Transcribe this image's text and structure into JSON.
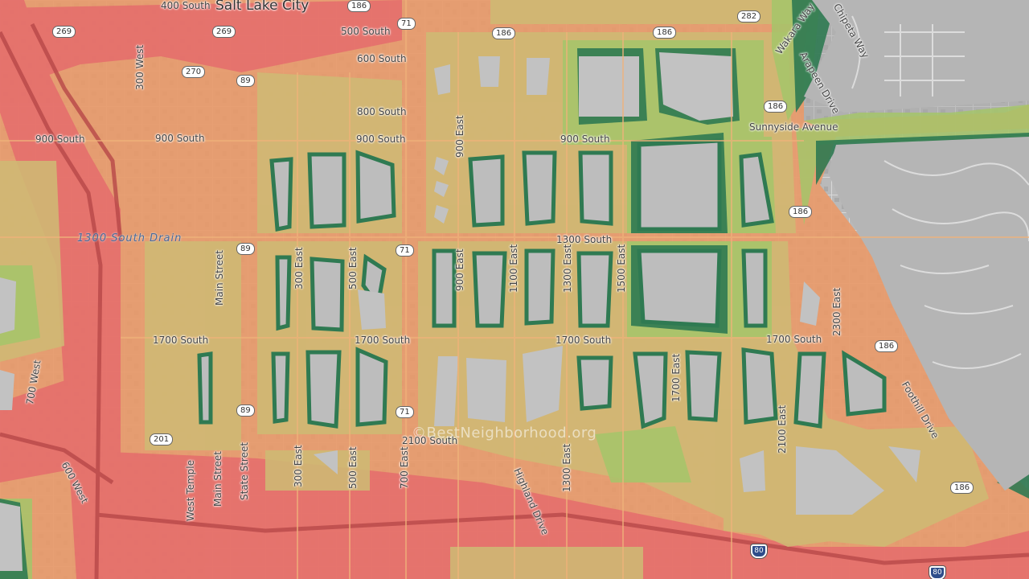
{
  "city_label": "Salt Lake City",
  "watermark": "©BestNeighborhood.org",
  "water_label": "1300 South Drain",
  "colors": {
    "base": "#b7b7b7",
    "hot": "#e56c6c",
    "warm": "#e89a6a",
    "mid": "#cfba74",
    "cool": "#a5c66a",
    "cold": "#2f7a52",
    "freeway_line": "#b84848"
  },
  "street_labels": [
    {
      "id": "400-south",
      "text": "400 South"
    },
    {
      "id": "500-south",
      "text": "500 South"
    },
    {
      "id": "600-south",
      "text": "600 South"
    },
    {
      "id": "800-south",
      "text": "800 South"
    },
    {
      "id": "900-south-w",
      "text": "900 South"
    },
    {
      "id": "900-south-c",
      "text": "900 South"
    },
    {
      "id": "900-south-m",
      "text": "900 South"
    },
    {
      "id": "900-south-e",
      "text": "900 South"
    },
    {
      "id": "1300-south",
      "text": "1300 South"
    },
    {
      "id": "1700-south-w",
      "text": "1700 South"
    },
    {
      "id": "1700-south-c",
      "text": "1700 South"
    },
    {
      "id": "1700-south-m",
      "text": "1700 South"
    },
    {
      "id": "1700-south-e",
      "text": "1700 South"
    },
    {
      "id": "2100-south",
      "text": "2100 South"
    },
    {
      "id": "sunnyside",
      "text": "Sunnyside Avenue"
    },
    {
      "id": "300-west",
      "text": "300 West"
    },
    {
      "id": "main-street-n",
      "text": "Main Street"
    },
    {
      "id": "300-east-n",
      "text": "300 East"
    },
    {
      "id": "500-east-n",
      "text": "500 East"
    },
    {
      "id": "900-east-n",
      "text": "900 East"
    },
    {
      "id": "900-east-m",
      "text": "900 East"
    },
    {
      "id": "1100-east",
      "text": "1100 East"
    },
    {
      "id": "1300-east-m",
      "text": "1300 East"
    },
    {
      "id": "1500-east",
      "text": "1500 East"
    },
    {
      "id": "1700-east",
      "text": "1700 East"
    },
    {
      "id": "2100-east",
      "text": "2100 East"
    },
    {
      "id": "2300-east",
      "text": "2300 East"
    },
    {
      "id": "700-west",
      "text": "700 West"
    },
    {
      "id": "600-west",
      "text": "600 West"
    },
    {
      "id": "west-temple",
      "text": "West Temple"
    },
    {
      "id": "main-street-s",
      "text": "Main Street"
    },
    {
      "id": "state-street",
      "text": "State Street"
    },
    {
      "id": "300-east-s",
      "text": "300 East"
    },
    {
      "id": "500-east-s",
      "text": "500 East"
    },
    {
      "id": "700-east",
      "text": "700 East"
    },
    {
      "id": "1300-east-s",
      "text": "1300 East"
    },
    {
      "id": "highland-drive",
      "text": "Highland Drive"
    },
    {
      "id": "foothill-drive",
      "text": "Foothill Drive"
    },
    {
      "id": "wakara-way",
      "text": "Wakara Way"
    },
    {
      "id": "arapeen-drive",
      "text": "Arapeen Drive"
    },
    {
      "id": "chipeta-way",
      "text": "Chipeta Way"
    }
  ],
  "route_shields": [
    {
      "id": "r186-a",
      "text": "186"
    },
    {
      "id": "r186-b",
      "text": "186"
    },
    {
      "id": "r186-c",
      "text": "186"
    },
    {
      "id": "r186-d",
      "text": "186"
    },
    {
      "id": "r186-e",
      "text": "186"
    },
    {
      "id": "r186-f",
      "text": "186"
    },
    {
      "id": "r186-g",
      "text": "186"
    },
    {
      "id": "r269-a",
      "text": "269"
    },
    {
      "id": "r269-b",
      "text": "269"
    },
    {
      "id": "r270",
      "text": "270"
    },
    {
      "id": "r282",
      "text": "282"
    },
    {
      "id": "r71-a",
      "text": "71"
    },
    {
      "id": "r71-b",
      "text": "71"
    },
    {
      "id": "r71-c",
      "text": "71"
    },
    {
      "id": "r89-a",
      "text": "89"
    },
    {
      "id": "r89-b",
      "text": "89"
    },
    {
      "id": "r89-c",
      "text": "89"
    },
    {
      "id": "r201",
      "text": "201"
    }
  ],
  "interstate_shields": [
    {
      "id": "i80-a",
      "text": "80"
    },
    {
      "id": "i80-b",
      "text": "80"
    }
  ]
}
